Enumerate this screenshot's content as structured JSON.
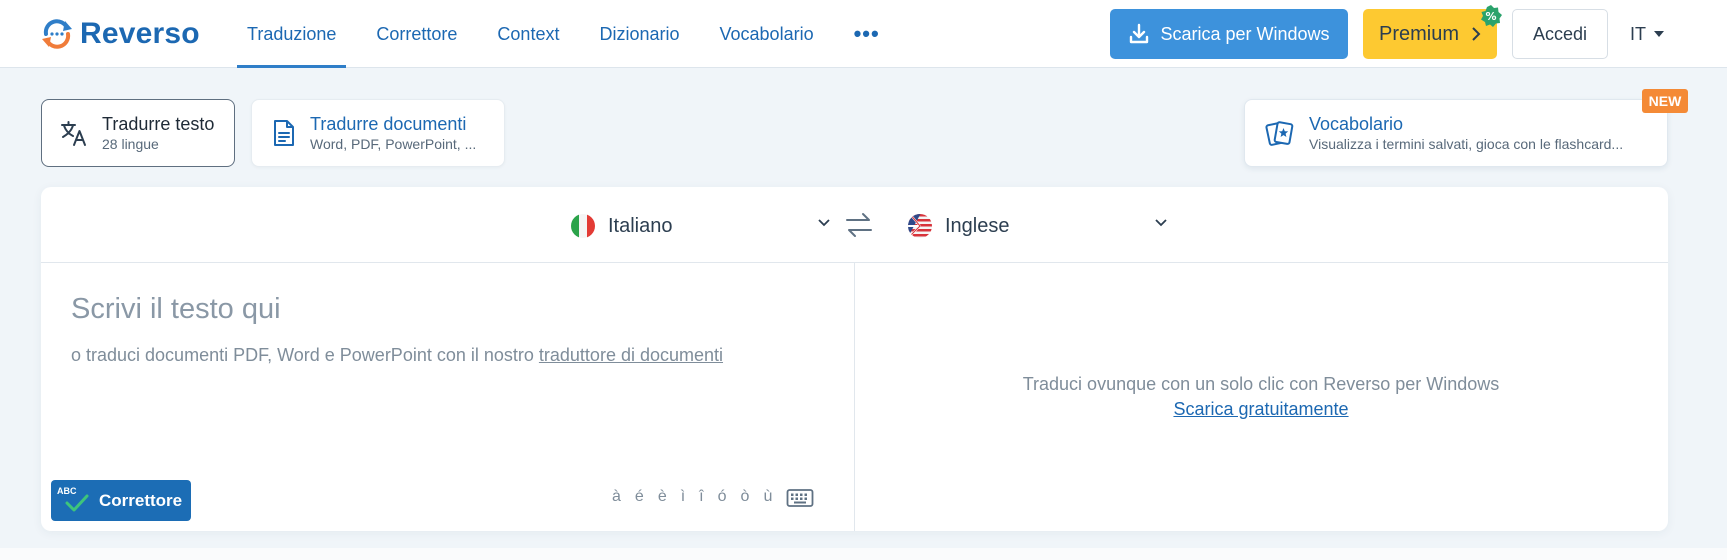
{
  "header": {
    "logo_text": "Reverso",
    "nav": [
      {
        "label": "Traduzione",
        "active": true
      },
      {
        "label": "Correttore"
      },
      {
        "label": "Context"
      },
      {
        "label": "Dizionario"
      },
      {
        "label": "Vocabolario"
      }
    ],
    "more_label": "•••",
    "download_label": "Scarica per Windows",
    "premium_label": "Premium",
    "premium_badge": "%",
    "login_label": "Accedi",
    "ui_language": "IT"
  },
  "modes": {
    "translate_text": {
      "title": "Tradurre testo",
      "subtitle": "28 lingue"
    },
    "translate_docs": {
      "title": "Tradurre documenti",
      "subtitle": "Word, PDF, PowerPoint, ..."
    },
    "vocabulary": {
      "title": "Vocabolario",
      "subtitle": "Visualizza i termini salvati, gioca con le flashcard...",
      "badge": "NEW"
    }
  },
  "translator": {
    "source_language": "Italiano",
    "target_language": "Inglese",
    "input_placeholder": "Scrivi il testo qui",
    "hint_prefix": "o traduci documenti PDF, Word e PowerPoint con il nostro",
    "hint_link": "traduttore di documenti",
    "corrector_badge": "ABC",
    "corrector_label": "Correttore",
    "accents": [
      "à",
      "é",
      "è",
      "ì",
      "î",
      "ó",
      "ò",
      "ù"
    ],
    "promo_text": "Traduci ovunque con un solo clic con Reverso per Windows",
    "promo_link": "Scarica gratuitamente"
  },
  "colors": {
    "brand": "#1c68b2",
    "download_button": "#3d92dc",
    "premium_button": "#fdc931",
    "new_badge": "#f48a36",
    "corrector_button": "#1c6db5"
  }
}
